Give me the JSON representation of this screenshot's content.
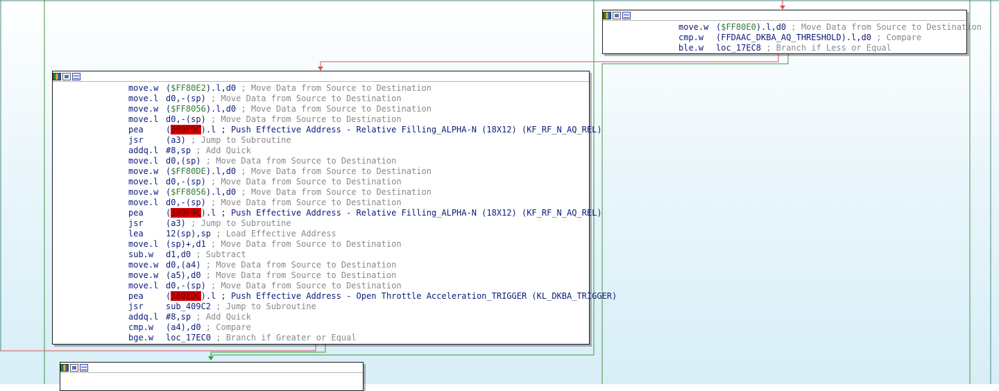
{
  "colors": {
    "edge_false": "#e05050",
    "edge_true": "#3a9a3a",
    "edge_normal": "#4a8a8a",
    "address_green": "#2e7d32",
    "highlight_red": "#d40000"
  },
  "node_toolbar_icons": [
    "graph-overview-icon",
    "edit-node-icon",
    "text-view-icon"
  ],
  "nodes": {
    "top_right": {
      "lines": [
        {
          "mnemonic": "move.w",
          "parts": [
            {
              "t": "("
            },
            {
              "t": "$FF80E0",
              "c": "g"
            },
            {
              "t": ").l,d0"
            }
          ],
          "comment": "; Move Data from Source to Destination"
        },
        {
          "mnemonic": "cmp.w",
          "parts": [
            {
              "t": "(FFDAAC_DKBA_AQ_THRESHOLD).l,d0"
            }
          ],
          "comment": "; Compare"
        },
        {
          "mnemonic": "ble.w",
          "parts": [
            {
              "t": "loc_17EC8"
            }
          ],
          "comment": "; Branch if Less or Equal"
        }
      ]
    },
    "main": {
      "lines": [
        {
          "mnemonic": "move.w",
          "parts": [
            {
              "t": "("
            },
            {
              "t": "$FF80E2",
              "c": "g"
            },
            {
              "t": ").l,d0"
            }
          ],
          "comment": "; Move Data from Source to Destination"
        },
        {
          "mnemonic": "move.l",
          "parts": [
            {
              "t": "d0,-(sp)"
            }
          ],
          "comment": "; Move Data from Source to Destination"
        },
        {
          "mnemonic": "move.w",
          "parts": [
            {
              "t": "("
            },
            {
              "t": "$FF8056",
              "c": "g"
            },
            {
              "t": ").l,d0"
            }
          ],
          "comment": "; Move Data from Source to Destination"
        },
        {
          "mnemonic": "move.l",
          "parts": [
            {
              "t": "d0,-(sp)"
            }
          ],
          "comment": "; Move Data from Source to Destination"
        },
        {
          "mnemonic": "pea",
          "parts": [
            {
              "t": "("
            },
            {
              "t": "389F9C",
              "c": "hl"
            },
            {
              "t": ").l ; Push Effective Address - Relative Filling_ALPHA-N (18X12) (KF_RF_N_AQ_REL)",
              "c": "ln"
            }
          ],
          "comment": ""
        },
        {
          "mnemonic": "jsr",
          "parts": [
            {
              "t": "(a3)"
            }
          ],
          "comment": "; Jump to Subroutine"
        },
        {
          "mnemonic": "addq.l",
          "parts": [
            {
              "t": "#8,sp"
            }
          ],
          "comment": "; Add Quick"
        },
        {
          "mnemonic": "move.l",
          "parts": [
            {
              "t": "d0,(sp)"
            }
          ],
          "comment": "; Move Data from Source to Destination"
        },
        {
          "mnemonic": "move.w",
          "parts": [
            {
              "t": "("
            },
            {
              "t": "$FF80DE",
              "c": "g"
            },
            {
              "t": ").l,d0"
            }
          ],
          "comment": "; Move Data from Source to Destination"
        },
        {
          "mnemonic": "move.l",
          "parts": [
            {
              "t": "d0,-(sp)"
            }
          ],
          "comment": "; Move Data from Source to Destination"
        },
        {
          "mnemonic": "move.w",
          "parts": [
            {
              "t": "("
            },
            {
              "t": "$FF8056",
              "c": "g"
            },
            {
              "t": ").l,d0"
            }
          ],
          "comment": "; Move Data from Source to Destination"
        },
        {
          "mnemonic": "move.l",
          "parts": [
            {
              "t": "d0,-(sp)"
            }
          ],
          "comment": "; Move Data from Source to Destination"
        },
        {
          "mnemonic": "pea",
          "parts": [
            {
              "t": "("
            },
            {
              "t": "389F9C",
              "c": "hl"
            },
            {
              "t": ").l ; Push Effective Address - Relative Filling_ALPHA-N (18X12) (KF_RF_N_AQ_REL)",
              "c": "ln"
            }
          ],
          "comment": ""
        },
        {
          "mnemonic": "jsr",
          "parts": [
            {
              "t": "(a3)"
            }
          ],
          "comment": "; Jump to Subroutine"
        },
        {
          "mnemonic": "lea",
          "parts": [
            {
              "t": "12(sp),sp"
            }
          ],
          "comment": "; Load Effective Address"
        },
        {
          "mnemonic": "move.l",
          "parts": [
            {
              "t": "(sp)+,d1"
            }
          ],
          "comment": "; Move Data from Source to Destination"
        },
        {
          "mnemonic": "sub.w",
          "parts": [
            {
              "t": "d1,d0"
            }
          ],
          "comment": "; Subtract"
        },
        {
          "mnemonic": "move.w",
          "parts": [
            {
              "t": "d0,(a4)"
            }
          ],
          "comment": "; Move Data from Source to Destination"
        },
        {
          "mnemonic": "move.w",
          "parts": [
            {
              "t": "(a5),d0"
            }
          ],
          "comment": "; Move Data from Source to Destination"
        },
        {
          "mnemonic": "move.l",
          "parts": [
            {
              "t": "d0,-(sp)"
            }
          ],
          "comment": "; Move Data from Source to Destination"
        },
        {
          "mnemonic": "pea",
          "parts": [
            {
              "t": "("
            },
            {
              "t": "389EDC",
              "c": "hl"
            },
            {
              "t": ").l ; Push Effective Address - Open Throttle Acceleration_TRIGGER (KL_DKBA_TRIGGER)",
              "c": "ln"
            }
          ],
          "comment": ""
        },
        {
          "mnemonic": "jsr",
          "parts": [
            {
              "t": "sub_409C2"
            }
          ],
          "comment": "; Jump to Subroutine"
        },
        {
          "mnemonic": "addq.l",
          "parts": [
            {
              "t": "#8,sp"
            }
          ],
          "comment": "; Add Quick"
        },
        {
          "mnemonic": "cmp.w",
          "parts": [
            {
              "t": "(a4),d0"
            }
          ],
          "comment": "; Compare"
        },
        {
          "mnemonic": "bge.w",
          "parts": [
            {
              "t": "loc_17EC0"
            }
          ],
          "comment": "; Branch if Greater or Equal"
        }
      ]
    },
    "bottom": {
      "lines": []
    }
  }
}
